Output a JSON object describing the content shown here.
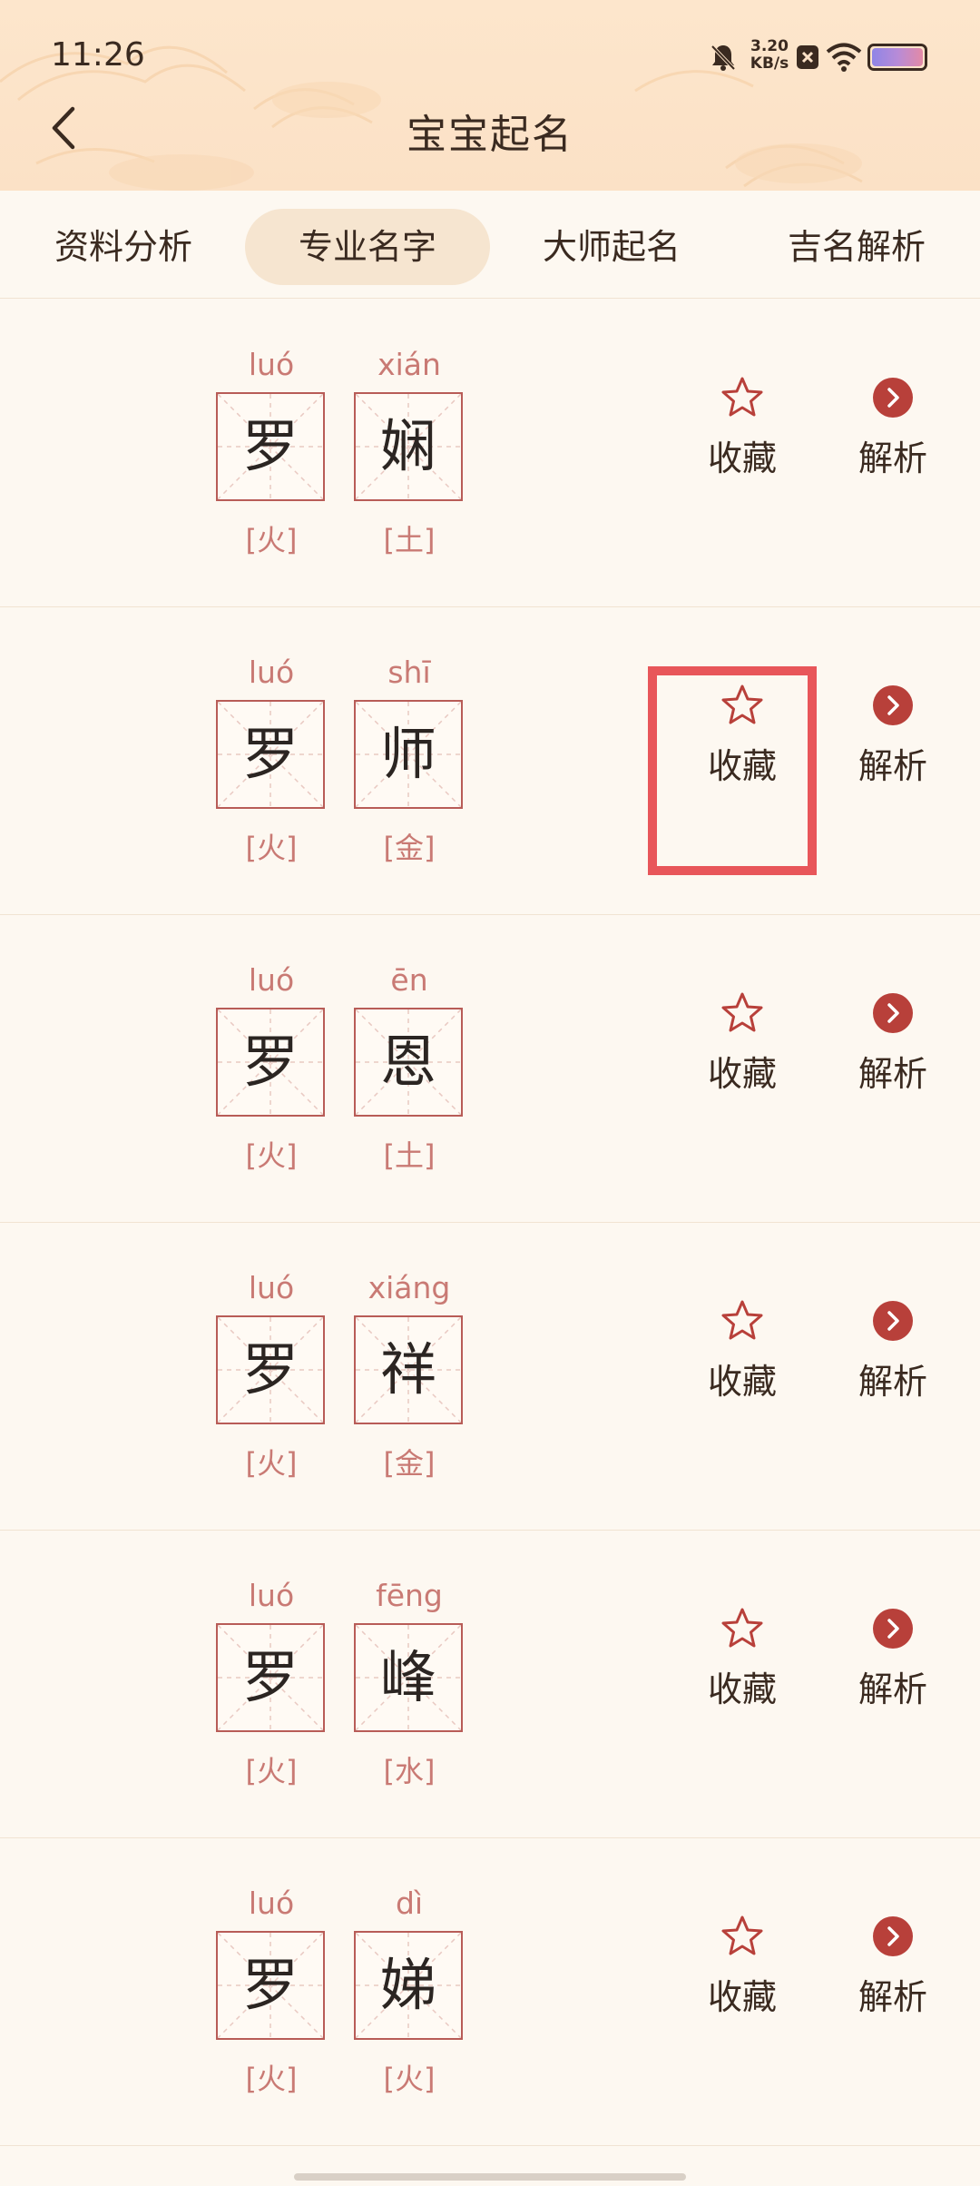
{
  "status_bar": {
    "time": "11:26",
    "net_speed_value": "3.20",
    "net_speed_unit": "KB/s"
  },
  "header": {
    "title": "宝宝起名"
  },
  "tabs": [
    {
      "label": "资料分析",
      "active": false
    },
    {
      "label": "专业名字",
      "active": true
    },
    {
      "label": "大师起名",
      "active": false
    },
    {
      "label": "吉名解析",
      "active": false
    }
  ],
  "names": [
    {
      "chars": [
        {
          "pinyin": "luó",
          "char": "罗",
          "element": "[火]"
        },
        {
          "pinyin": "xián",
          "char": "娴",
          "element": "[土]"
        }
      ],
      "favorite_label": "收藏",
      "analysis_label": "解析"
    },
    {
      "chars": [
        {
          "pinyin": "luó",
          "char": "罗",
          "element": "[火]"
        },
        {
          "pinyin": "shī",
          "char": "师",
          "element": "[金]"
        }
      ],
      "favorite_label": "收藏",
      "analysis_label": "解析"
    },
    {
      "chars": [
        {
          "pinyin": "luó",
          "char": "罗",
          "element": "[火]"
        },
        {
          "pinyin": "ēn",
          "char": "恩",
          "element": "[土]"
        }
      ],
      "favorite_label": "收藏",
      "analysis_label": "解析"
    },
    {
      "chars": [
        {
          "pinyin": "luó",
          "char": "罗",
          "element": "[火]"
        },
        {
          "pinyin": "xiáng",
          "char": "祥",
          "element": "[金]"
        }
      ],
      "favorite_label": "收藏",
      "analysis_label": "解析"
    },
    {
      "chars": [
        {
          "pinyin": "luó",
          "char": "罗",
          "element": "[火]"
        },
        {
          "pinyin": "fēng",
          "char": "峰",
          "element": "[水]"
        }
      ],
      "favorite_label": "收藏",
      "analysis_label": "解析"
    },
    {
      "chars": [
        {
          "pinyin": "luó",
          "char": "罗",
          "element": "[火]"
        },
        {
          "pinyin": "dì",
          "char": "娣",
          "element": "[火]"
        }
      ],
      "favorite_label": "收藏",
      "analysis_label": "解析"
    }
  ],
  "icons": {
    "favorite": "star-outline-icon",
    "analysis": "arrow-circle-icon",
    "back": "chevron-left-icon"
  },
  "colors": {
    "accent": "#b8403a",
    "pinyin": "#c97a74",
    "highlight": "#e8565a"
  }
}
